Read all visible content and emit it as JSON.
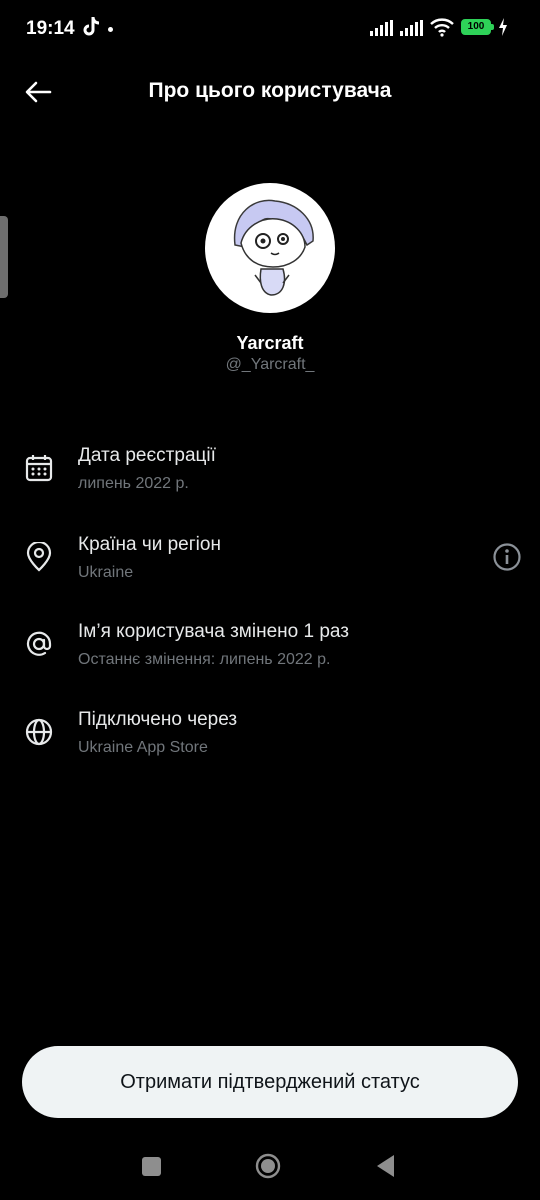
{
  "status_bar": {
    "time": "19:14",
    "battery": "100",
    "icons": [
      "tiktok-icon",
      "signal-icon",
      "wifi-icon",
      "battery-icon",
      "charging-icon"
    ]
  },
  "header": {
    "title": "Про цього користувача",
    "back_icon": "arrow-left-icon"
  },
  "profile": {
    "display_name": "Yarcraft",
    "handle": "@_Yarcraft_"
  },
  "info_rows": [
    {
      "icon": "calendar-icon",
      "title": "Дата реєстрації",
      "subtitle": "липень 2022 р."
    },
    {
      "icon": "location-pin-icon",
      "title": "Країна чи регіон",
      "subtitle": "Ukraine",
      "action_icon": "info-icon"
    },
    {
      "icon": "at-sign-icon",
      "title": "Ім’я користувача змінено 1 раз",
      "subtitle": "Останнє змінення: липень 2022 р."
    },
    {
      "icon": "globe-icon",
      "title": "Підключено через",
      "subtitle": "Ukraine App Store"
    }
  ],
  "verify_button": {
    "label": "Отримати підтверджений статус"
  },
  "colors": {
    "background": "#000000",
    "primary_text": "#e7e9ea",
    "secondary_text": "#71767b",
    "button_bg": "#eff3f4",
    "battery": "#2ed158"
  }
}
